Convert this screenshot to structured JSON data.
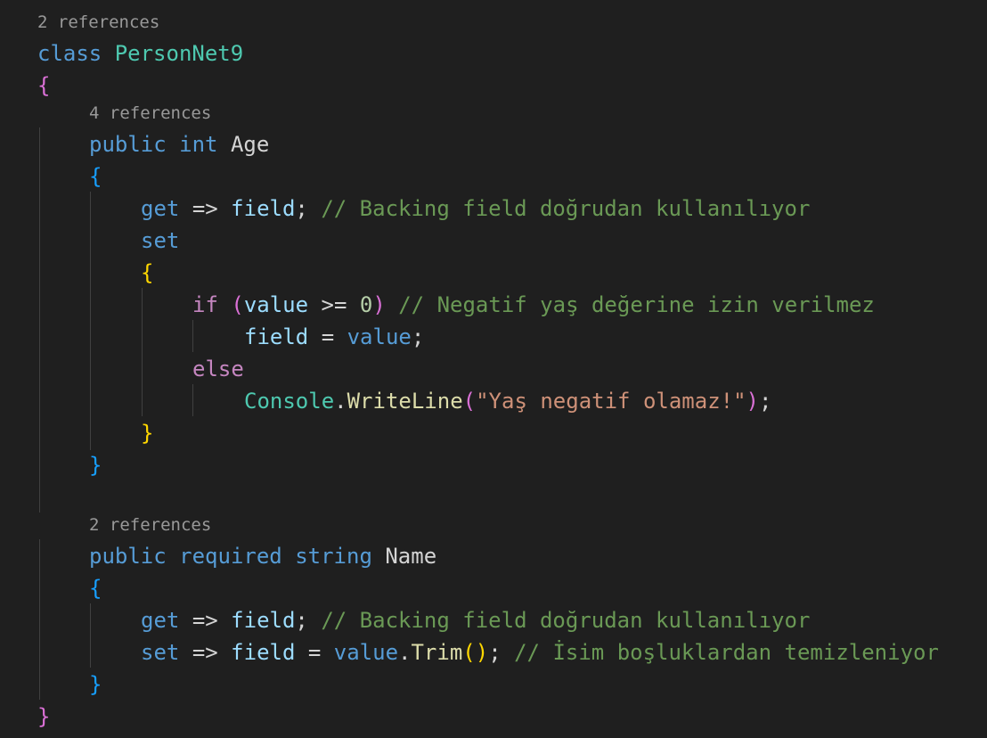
{
  "editor": {
    "language": "csharp",
    "theme_colors": {
      "background": "#1f1f1f",
      "keyword": "#569cd6",
      "control": "#c586c0",
      "type": "#4ec9b0",
      "variable": "#9cdcfe",
      "method": "#dcdcaa",
      "string": "#ce9178",
      "comment": "#6a9955",
      "codelens": "#999999",
      "bracket_1": "#da70d6",
      "bracket_2": "#179fff",
      "bracket_3": "#ffd700"
    },
    "codelens": {
      "class": "2 references",
      "age": "4 references",
      "name": "2 references"
    },
    "tokens": {
      "class_kw": "class",
      "class_name": "PersonNet9",
      "open_brace": "{",
      "close_brace": "}",
      "public_kw": "public",
      "int_kw": "int",
      "age_name": "Age",
      "get_kw": "get",
      "set_kw": "set",
      "arrow": "=>",
      "field_kw": "field",
      "semicolon": ";",
      "comment_backing": "// Backing field doğrudan kullanılıyor",
      "if_kw": "if",
      "open_paren": "(",
      "close_paren": ")",
      "value_kw": "value",
      "gte_op": ">=",
      "zero": "0",
      "comment_negative": "// Negatif yaş değerine izin verilmez",
      "assign_op": "=",
      "else_kw": "else",
      "console_type": "Console",
      "dot": ".",
      "writeline_method": "WriteLine",
      "string_literal": "\"Yaş negatif olamaz!\"",
      "required_kw": "required",
      "string_kw": "string",
      "name_name": "Name",
      "trim_method": "Trim",
      "comment_trim": "// İsim boşluklardan temizleniyor"
    }
  }
}
